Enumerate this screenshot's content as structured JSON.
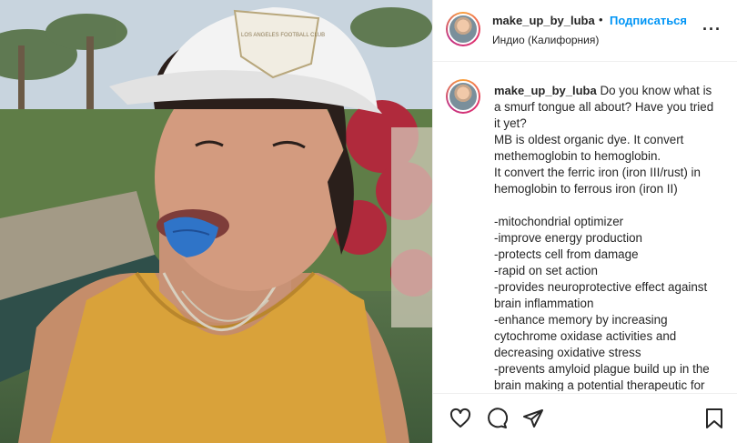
{
  "post": {
    "username": "make_up_by_luba",
    "dot": "•",
    "follow_label": "Подписаться",
    "location": "Индио (Калифорния)",
    "more_label": "···"
  },
  "caption": {
    "username": "make_up_by_luba",
    "lines": [
      "Do you know what is",
      "a smurf tongue all about? Have you tried",
      "it yet?",
      "MB is oldest organic dye. It convert",
      "methemoglobin to hemoglobin.",
      "It convert the ferric iron (iron III/rust) in",
      "hemoglobin to ferrous iron (iron II)",
      "",
      "-mitochondrial optimizer",
      "-improve energy production",
      "-protects cell from damage",
      "-rapid on set action",
      "-provides neuroprotective effect against",
      "brain inflammation",
      "-enhance memory by increasing",
      "cytochrome oxidase activities and",
      "decreasing oxidative stress",
      "-prevents amyloid plague build up in the",
      "brain making a potential therapeutic for"
    ]
  },
  "cap_text": "LOS ANGELES FOOTBALL CLUB",
  "icons": {
    "like": "heart-icon",
    "comment": "comment-icon",
    "share": "paper-plane-icon",
    "save": "bookmark-icon",
    "more": "more-dots-icon"
  },
  "colors": {
    "accent": "#0095f6",
    "text": "#262626",
    "divider": "#efefef",
    "tongue": "#2f74c8",
    "top": "#d9a23a"
  }
}
